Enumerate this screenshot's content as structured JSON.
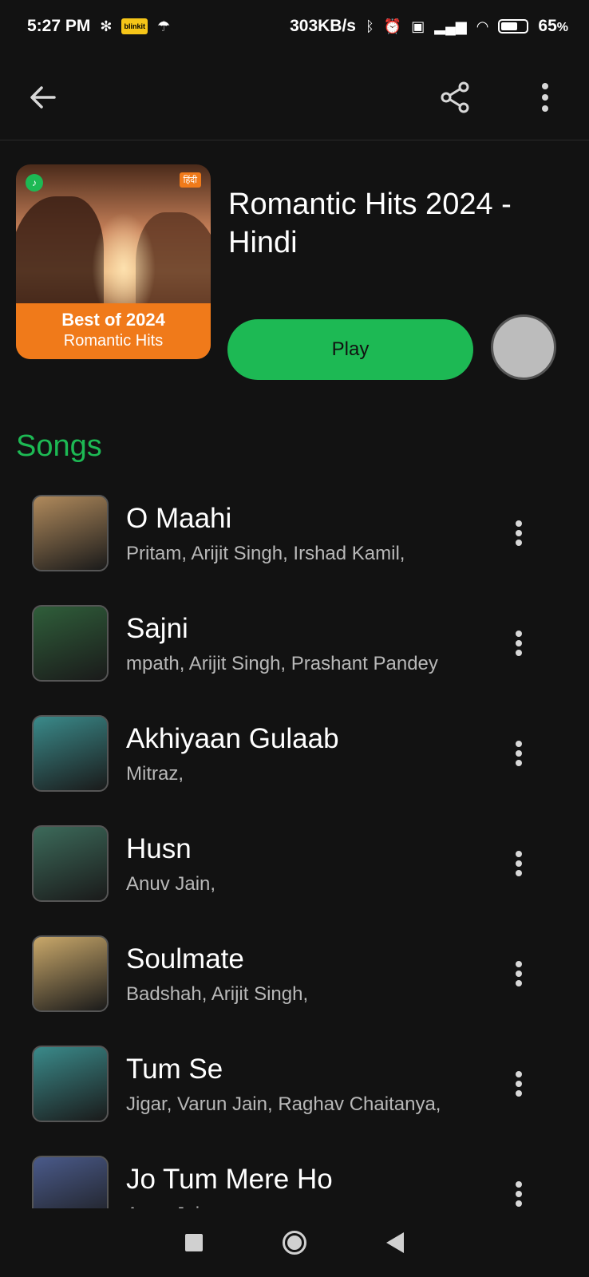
{
  "status_bar": {
    "time": "5:27 PM",
    "app_badge": "blinkit",
    "speed": "303KB/s",
    "battery": "65",
    "battery_unit": "%",
    "battery_fraction": 0.65
  },
  "toolbar": {
    "back_icon": "arrow-left-icon",
    "share_icon": "share-icon",
    "more_icon": "more-vertical-icon"
  },
  "playlist": {
    "title": "Romantic Hits 2024 - Hindi",
    "cover_line1": "Best of 2024",
    "cover_line2": "Romantic Hits",
    "cover_lang": "हिंदी",
    "play_label": "Play"
  },
  "songs_section": {
    "title": "Songs",
    "items": [
      {
        "title": "O Maahi",
        "artists": "Pritam, Arijit Singh, Irshad Kamil,",
        "thumb_color": "#b08a5c"
      },
      {
        "title": "Sajni",
        "artists": "mpath, Arijit Singh, Prashant Pandey",
        "thumb_color": "#2f5e3a"
      },
      {
        "title": "Akhiyaan Gulaab",
        "artists": "Mitraz,",
        "thumb_color": "#3a8a8a"
      },
      {
        "title": "Husn",
        "artists": "Anuv Jain,",
        "thumb_color": "#3c6a5a"
      },
      {
        "title": "Soulmate",
        "artists": "Badshah, Arijit Singh,",
        "thumb_color": "#c9a86a"
      },
      {
        "title": "Tum Se",
        "artists": "Jigar, Varun Jain, Raghav Chaitanya,",
        "thumb_color": "#3a8a8a"
      },
      {
        "title": "Jo Tum Mere Ho",
        "artists": "Anuv Jain,",
        "thumb_color": "#4a5a8a"
      }
    ]
  },
  "colors": {
    "accent": "#1db954",
    "background": "#121212"
  }
}
